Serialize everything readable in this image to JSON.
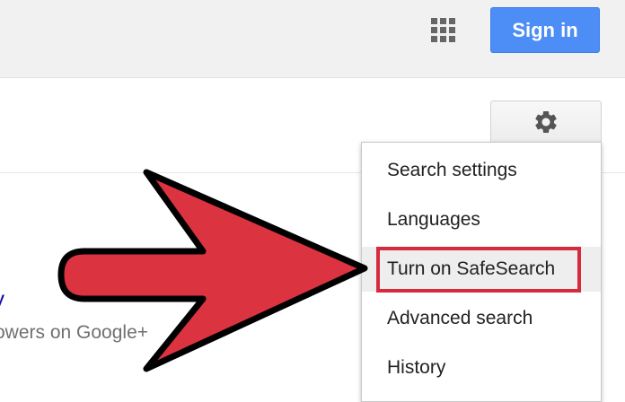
{
  "header": {
    "apps_icon": "apps-grid-icon",
    "signin_label": "Sign in",
    "signin_color": "#4c8df6"
  },
  "settings": {
    "gear_icon": "gear-icon",
    "menu": {
      "items": [
        {
          "label": "Search settings"
        },
        {
          "label": "Languages"
        },
        {
          "label": "Turn on SafeSearch",
          "highlighted": true
        },
        {
          "label": "Advanced search"
        },
        {
          "label": "History"
        }
      ]
    }
  },
  "background_result": {
    "title": "y",
    "snippet": "owers on Google+"
  },
  "annotation": {
    "arrow_icon": "pointer-arrow-icon",
    "arrow_color": "#dc3340",
    "highlight_color": "#d62b3e"
  }
}
